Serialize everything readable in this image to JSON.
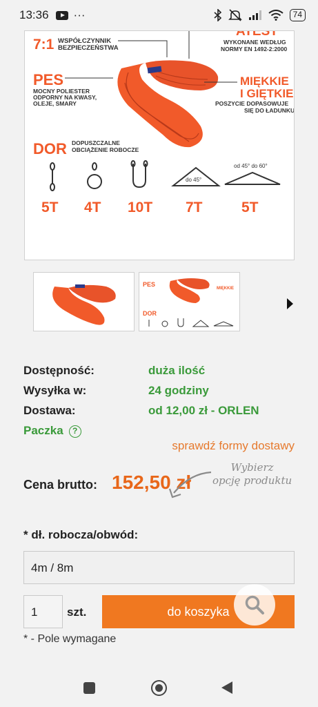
{
  "status_bar": {
    "time": "13:36",
    "more": "···",
    "battery": "74",
    "icons": [
      "youtube-icon",
      "bluetooth-icon",
      "mute-icon",
      "signal-icon",
      "wifi-icon",
      "battery-icon"
    ]
  },
  "product_image": {
    "safety_ratio": "7:1",
    "safety_text_1": "WSPÓŁCZYNNIK",
    "safety_text_2": "BEZPIECZEŃSTWA",
    "cert_title": "ATEST",
    "cert_text_1": "WYKONANE WEDŁUG",
    "cert_text_2": "NORMY EN 1492-2:2000",
    "pes_title": "PES",
    "pes_text_1": "MOCNY POLIESTER",
    "pes_text_2": "ODPORNY NA KWASY,",
    "pes_text_3": "OLEJE, SMARY",
    "soft_title_1": "MIĘKKIE",
    "soft_title_2": "I GIĘTKIE",
    "soft_text_1": "POSZYCIE DOPASOWUJE",
    "soft_text_2": "SIĘ DO ŁADUNKU",
    "dor_title": "DOR",
    "dor_text_1": "DOPUSZCZALNE",
    "dor_text_2": "OBCIĄŻENIE ROBOCZE",
    "angle_45": "do 45°",
    "angle_range": "od 45° do 60°",
    "loads": [
      "5T",
      "4T",
      "10T",
      "7T",
      "5T"
    ]
  },
  "thumbnails": {
    "next_label": "next"
  },
  "availability": {
    "label": "Dostępność:",
    "value": "duża ilość"
  },
  "shipping": {
    "label": "Wysyłka w:",
    "value": "24 godziny"
  },
  "delivery": {
    "label": "Dostawa:",
    "value": "od 12,00 zł - ORLEN",
    "value_2": "Paczka"
  },
  "check_delivery": "sprawdź formy dostawy",
  "price": {
    "label": "Cena brutto:",
    "value": "152,50 zł",
    "hint_1": "Wybierz",
    "hint_2": "opcję produktu"
  },
  "option": {
    "label": "* dł. robocza/obwód:",
    "selected": "4m / 8m"
  },
  "quantity": {
    "value": "1",
    "unit": "szt."
  },
  "cart_button": "do koszyka",
  "required_note": "* - Pole wymagane",
  "colors": {
    "accent_orange": "#f07820",
    "price_orange": "#e8671a",
    "green": "#3a9a3a",
    "sling_orange": "#f15a2a"
  }
}
